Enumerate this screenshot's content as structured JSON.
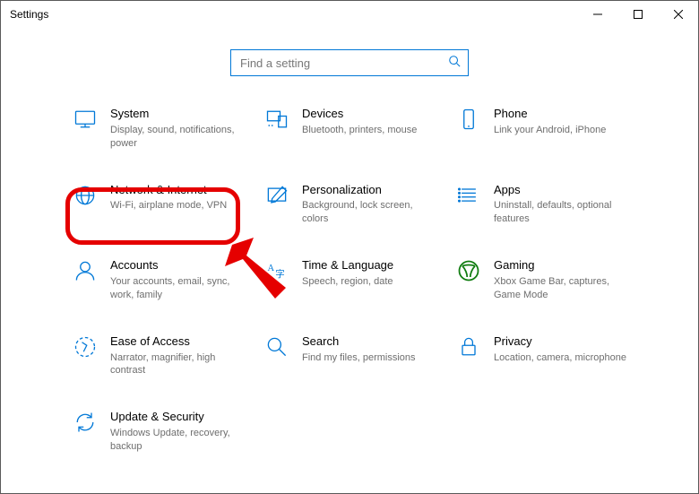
{
  "window": {
    "title": "Settings"
  },
  "search": {
    "placeholder": "Find a setting"
  },
  "colors": {
    "accent": "#0078d7",
    "highlight": "#e50000",
    "muted": "#6e6e6e"
  },
  "tiles": [
    {
      "id": "system",
      "title": "System",
      "desc": "Display, sound, notifications, power"
    },
    {
      "id": "devices",
      "title": "Devices",
      "desc": "Bluetooth, printers, mouse"
    },
    {
      "id": "phone",
      "title": "Phone",
      "desc": "Link your Android, iPhone"
    },
    {
      "id": "network",
      "title": "Network & Internet",
      "desc": "Wi-Fi, airplane mode, VPN"
    },
    {
      "id": "personal",
      "title": "Personalization",
      "desc": "Background, lock screen, colors"
    },
    {
      "id": "apps",
      "title": "Apps",
      "desc": "Uninstall, defaults, optional features"
    },
    {
      "id": "accounts",
      "title": "Accounts",
      "desc": "Your accounts, email, sync, work, family"
    },
    {
      "id": "time",
      "title": "Time & Language",
      "desc": "Speech, region, date"
    },
    {
      "id": "gaming",
      "title": "Gaming",
      "desc": "Xbox Game Bar, captures, Game Mode"
    },
    {
      "id": "ease",
      "title": "Ease of Access",
      "desc": "Narrator, magnifier, high contrast"
    },
    {
      "id": "searchc",
      "title": "Search",
      "desc": "Find my files, permissions"
    },
    {
      "id": "privacy",
      "title": "Privacy",
      "desc": "Location, camera, microphone"
    },
    {
      "id": "update",
      "title": "Update & Security",
      "desc": "Windows Update, recovery, backup"
    }
  ],
  "annotation": {
    "highlighted_tile": "network"
  }
}
